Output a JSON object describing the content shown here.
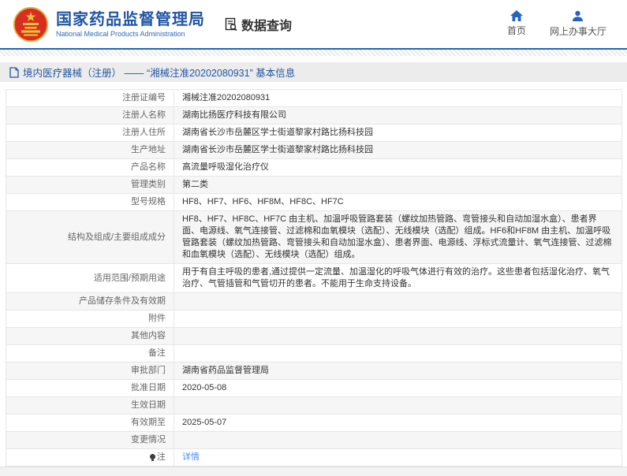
{
  "header": {
    "logo": {
      "title": "国家药品监督管理局",
      "subtitle": "National Medical Products Administration"
    },
    "nav": {
      "data_query": "数据查询",
      "home": "首页",
      "service_hall": "网上办事大厅"
    }
  },
  "breadcrumb": {
    "text": "境内医疗器械（注册） —— “湘械注准20202080931” 基本信息"
  },
  "detail_table": {
    "rows": [
      {
        "label": "注册证编号",
        "value": "湘械注准20202080931"
      },
      {
        "label": "注册人名称",
        "value": "湖南比扬医疗科技有限公司"
      },
      {
        "label": "注册人住所",
        "value": "湖南省长沙市岳麓区学士街道黎家村路比扬科技园"
      },
      {
        "label": "生产地址",
        "value": "湖南省长沙市岳麓区学士街道黎家村路比扬科技园"
      },
      {
        "label": "产品名称",
        "value": "高流量呼吸湿化治疗仪"
      },
      {
        "label": "管理类别",
        "value": "第二类"
      },
      {
        "label": "型号规格",
        "value": "HF8、HF7、HF6、HF8M、HF8C、HF7C"
      },
      {
        "label": "结构及组成/主要组成成分",
        "value": "HF8、HF7、HF8C、HF7C 由主机、加温呼吸管路套装（螺纹加热管路、弯管接头和自动加湿水盒）、患者界面、电源线、氧气连接管、过滤棉和血氧模块（选配）、无线模块（选配）组成。HF6和HF8M 由主机、加温呼吸管路套装（螺纹加热管路、弯管接头和自动加湿水盒）、患者界面、电源线、浮标式流量计、氧气连接管、过滤棉和血氧模块（选配）、无线模块（选配）组成。"
      },
      {
        "label": "适用范围/预期用途",
        "value": "用于有自主呼吸的患者,通过提供一定流量、加温湿化的呼吸气体进行有效的治疗。这些患者包括湿化治疗、氧气治疗、气管插管和气管切开的患者。不能用于生命支持设备。"
      },
      {
        "label": "产品储存条件及有效期",
        "value": ""
      },
      {
        "label": "附件",
        "value": ""
      },
      {
        "label": "其他内容",
        "value": ""
      },
      {
        "label": "备注",
        "value": ""
      },
      {
        "label": "审批部门",
        "value": "湖南省药品监督管理局"
      },
      {
        "label": "批准日期",
        "value": "2020-05-08"
      },
      {
        "label": "生效日期",
        "value": ""
      },
      {
        "label": "有效期至",
        "value": "2025-05-07"
      },
      {
        "label": "变更情况",
        "value": ""
      },
      {
        "label": "注",
        "value": "详情",
        "link": true,
        "icon": "bulb-icon"
      }
    ]
  },
  "icons": {
    "logo": "national-emblem-icon",
    "data_query": "document-search-icon",
    "home": "home-icon",
    "service_hall": "user-icon",
    "breadcrumb": "document-icon",
    "note": "bulb-icon"
  },
  "colors": {
    "brand_blue": "#2155a3",
    "line_blue": "#2862ae",
    "icon_blue": "#2563c0",
    "link_blue": "#4e8cf0",
    "alt_row_bg": "#f6f6f6",
    "breadcrumb_bg": "#ececec"
  }
}
